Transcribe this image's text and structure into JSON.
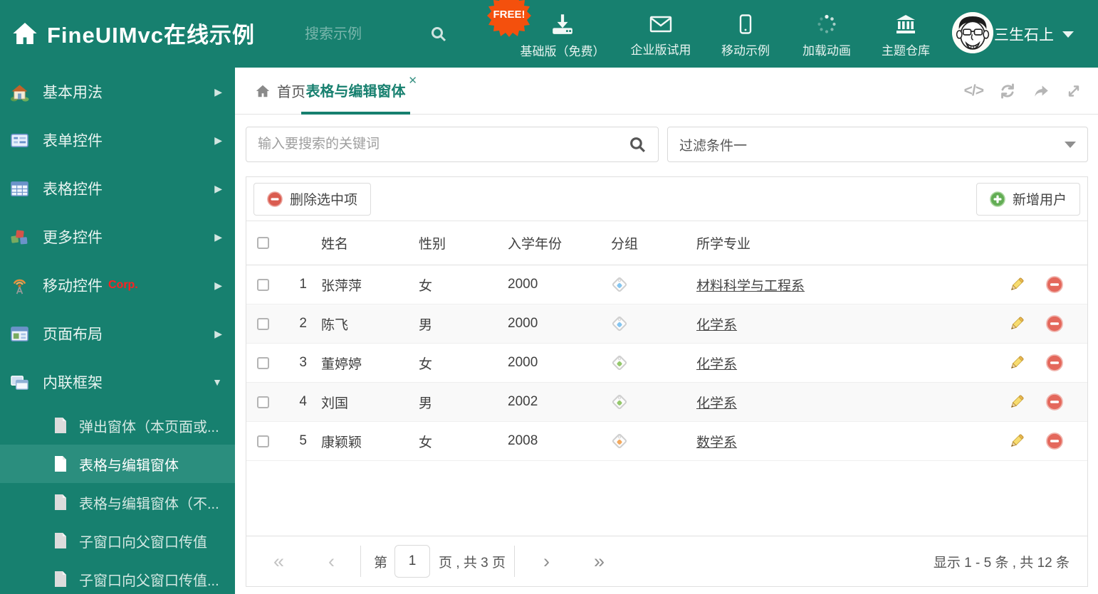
{
  "app": {
    "title": "FineUIMvc在线示例",
    "search_placeholder": "搜索示例",
    "free_badge": "FREE!",
    "nav": [
      {
        "label": "基础版（免费）"
      },
      {
        "label": "企业版试用"
      },
      {
        "label": "移动示例"
      },
      {
        "label": "加载动画"
      },
      {
        "label": "主题仓库"
      }
    ],
    "user_name": "三生石上",
    "colors": {
      "accent": "#17806f",
      "free_badge": "#f4500d",
      "selected_item": "#2b8e7e"
    }
  },
  "sidebar": {
    "items": [
      {
        "label": "基本用法"
      },
      {
        "label": "表单控件"
      },
      {
        "label": "表格控件"
      },
      {
        "label": "更多控件"
      },
      {
        "label": "移动控件",
        "badge": "Corp."
      },
      {
        "label": "页面布局"
      },
      {
        "label": "内联框架"
      }
    ],
    "subitems": [
      {
        "label": "弹出窗体（本页面或..."
      },
      {
        "label": "表格与编辑窗体"
      },
      {
        "label": "表格与编辑窗体（不..."
      },
      {
        "label": "子窗口向父窗口传值"
      },
      {
        "label": "子窗口向父窗口传值..."
      }
    ]
  },
  "tabs": {
    "home": "首页",
    "active": "表格与编辑窗体"
  },
  "filters": {
    "search_placeholder": "输入要搜索的关键词",
    "filter_value": "过滤条件一"
  },
  "toolbar": {
    "delete_selected": "删除选中项",
    "add_user": "新增用户"
  },
  "table": {
    "columns": [
      "姓名",
      "性别",
      "入学年份",
      "分组",
      "所学专业"
    ],
    "rows": [
      {
        "num": "1",
        "name": "张萍萍",
        "gender": "女",
        "year": "2000",
        "tag_color": "#85c5f0",
        "major": "材料科学与工程系"
      },
      {
        "num": "2",
        "name": "陈飞",
        "gender": "男",
        "year": "2000",
        "tag_color": "#85c5f0",
        "major": "化学系"
      },
      {
        "num": "3",
        "name": "董婷婷",
        "gender": "女",
        "year": "2000",
        "tag_color": "#95c86c",
        "major": "化学系"
      },
      {
        "num": "4",
        "name": "刘国",
        "gender": "男",
        "year": "2002",
        "tag_color": "#95c86c",
        "major": "化学系"
      },
      {
        "num": "5",
        "name": "康颖颖",
        "gender": "女",
        "year": "2008",
        "tag_color": "#f3a95e",
        "major": "数学系"
      }
    ]
  },
  "pagination": {
    "page_prefix": "第",
    "current_page": "1",
    "page_suffix": "页 , 共 3 页",
    "summary": "显示 1 - 5 条 , 共 12 条"
  },
  "glyphs": {
    "arrow_right": "▶",
    "arrow_down": "▼",
    "close": "✕",
    "code": "</>",
    "pager_first": "«",
    "pager_prev": "‹",
    "pager_next": "›",
    "pager_last": "»"
  }
}
